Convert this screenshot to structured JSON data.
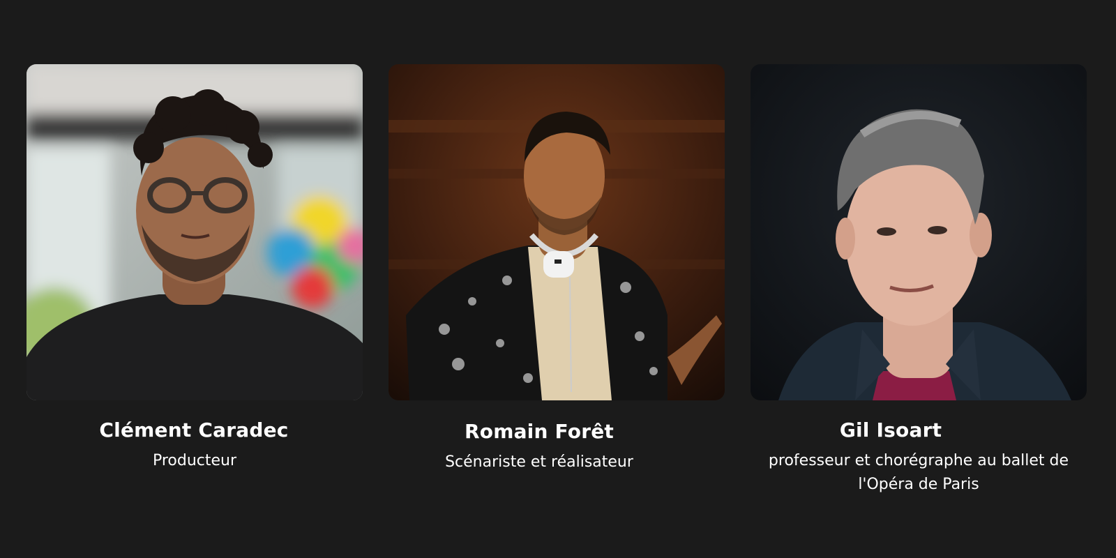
{
  "team": [
    {
      "name": "Clément Caradec",
      "role": "Producteur",
      "photo_icon": "portrait-photo"
    },
    {
      "name": "Romain Forêt",
      "role": "Scénariste et réalisateur",
      "photo_icon": "portrait-photo"
    },
    {
      "name": "Gil Isoart",
      "role": "professeur et chorégraphe au ballet de l'Opéra de Paris",
      "photo_icon": "portrait-photo"
    }
  ],
  "colors": {
    "background": "#1b1b1b",
    "text": "#ffffff"
  }
}
